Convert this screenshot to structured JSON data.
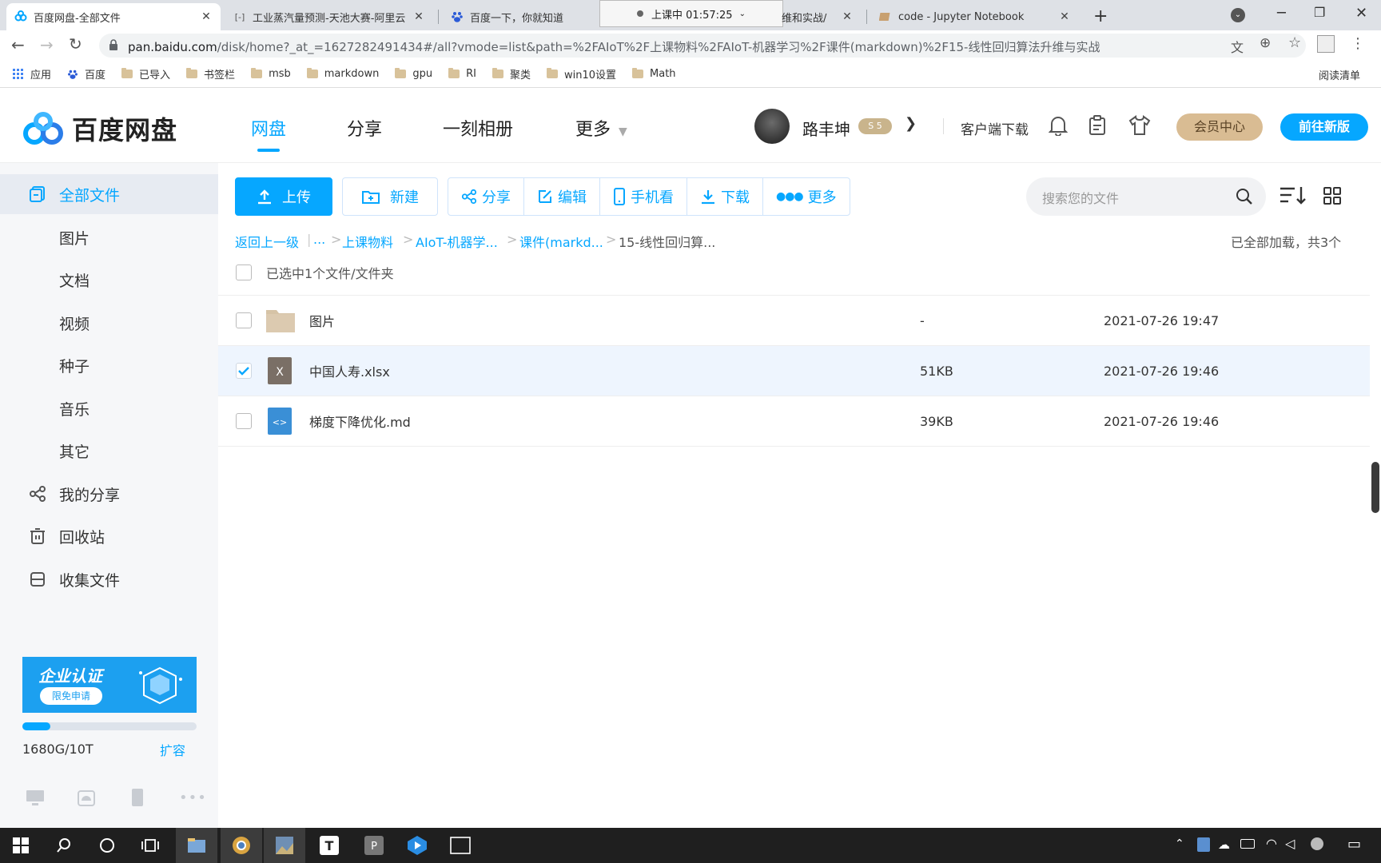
{
  "browser": {
    "tabs": [
      {
        "title": "百度网盘-全部文件",
        "active": true
      },
      {
        "title": "工业蒸汽量预测-天池大赛-阿里云",
        "active": false
      },
      {
        "title": "百度一下，你就知道",
        "active": false
      },
      {
        "title": "维和实战/",
        "active": false
      },
      {
        "title": "code - Jupyter Notebook",
        "active": false
      }
    ],
    "recording": "上课中 01:57:25",
    "url_host": "pan.baidu.com",
    "url_path": "/disk/home?_at_=1627282491434#/all?vmode=list&path=%2FAIoT%2F上课物料%2FAIoT-机器学习%2F课件(markdown)%2F15-线性回归算法升维与实战",
    "bookmarks": [
      "应用",
      "百度",
      "已导入",
      "书签栏",
      "msb",
      "markdown",
      "gpu",
      "RI",
      "聚类",
      "win10设置",
      "Math"
    ],
    "overlay_right": "阅读清单"
  },
  "header": {
    "logo_text": "百度网盘",
    "nav": [
      "网盘",
      "分享",
      "一刻相册",
      "更多"
    ],
    "username": "路丰坤",
    "client_download": "客户端下载",
    "vip_button": "会员中心",
    "new_version_button": "前往新版"
  },
  "sidebar": {
    "items": [
      {
        "label": "全部文件",
        "icon": "files-icon",
        "active": true
      },
      {
        "label": "图片"
      },
      {
        "label": "文档"
      },
      {
        "label": "视频"
      },
      {
        "label": "种子"
      },
      {
        "label": "音乐"
      },
      {
        "label": "其它"
      },
      {
        "label": "我的分享",
        "icon": "share-icon"
      },
      {
        "label": "回收站",
        "icon": "trash-icon"
      },
      {
        "label": "收集文件",
        "icon": "collect-icon"
      }
    ],
    "banner_title": "企业认证",
    "banner_button": "限免申请",
    "storage_text": "1680G/10T",
    "storage_used_fraction": 0.16,
    "expand_link": "扩容"
  },
  "toolbar": {
    "upload": "上传",
    "new": "新建",
    "share": "分享",
    "edit": "编辑",
    "mobile": "手机看",
    "download": "下载",
    "more": "更多",
    "search_placeholder": "搜索您的文件"
  },
  "breadcrumb": {
    "back": "返回上一级",
    "ellipsis": "...",
    "items": [
      "上课物料",
      "AIoT-机器学...",
      "课件(markd...",
      "15-线性回归算..."
    ],
    "loaded_status": "已全部加载，共3个"
  },
  "file_list": {
    "selection_text": "已选中1个文件/文件夹",
    "rows": [
      {
        "name": "图片",
        "size": "-",
        "date": "2021-07-26 19:47",
        "type": "folder",
        "checked": false
      },
      {
        "name": "中国人寿.xlsx",
        "size": "51KB",
        "date": "2021-07-26 19:46",
        "type": "xlsx",
        "checked": true
      },
      {
        "name": "梯度下降优化.md",
        "size": "39KB",
        "date": "2021-07-26 19:46",
        "type": "md",
        "checked": false
      }
    ]
  },
  "colors": {
    "accent": "#06a7ff",
    "vip": "#d9bc93",
    "sidebar_bg": "#f6f7f9",
    "taskbar": "#1f1f1f"
  }
}
